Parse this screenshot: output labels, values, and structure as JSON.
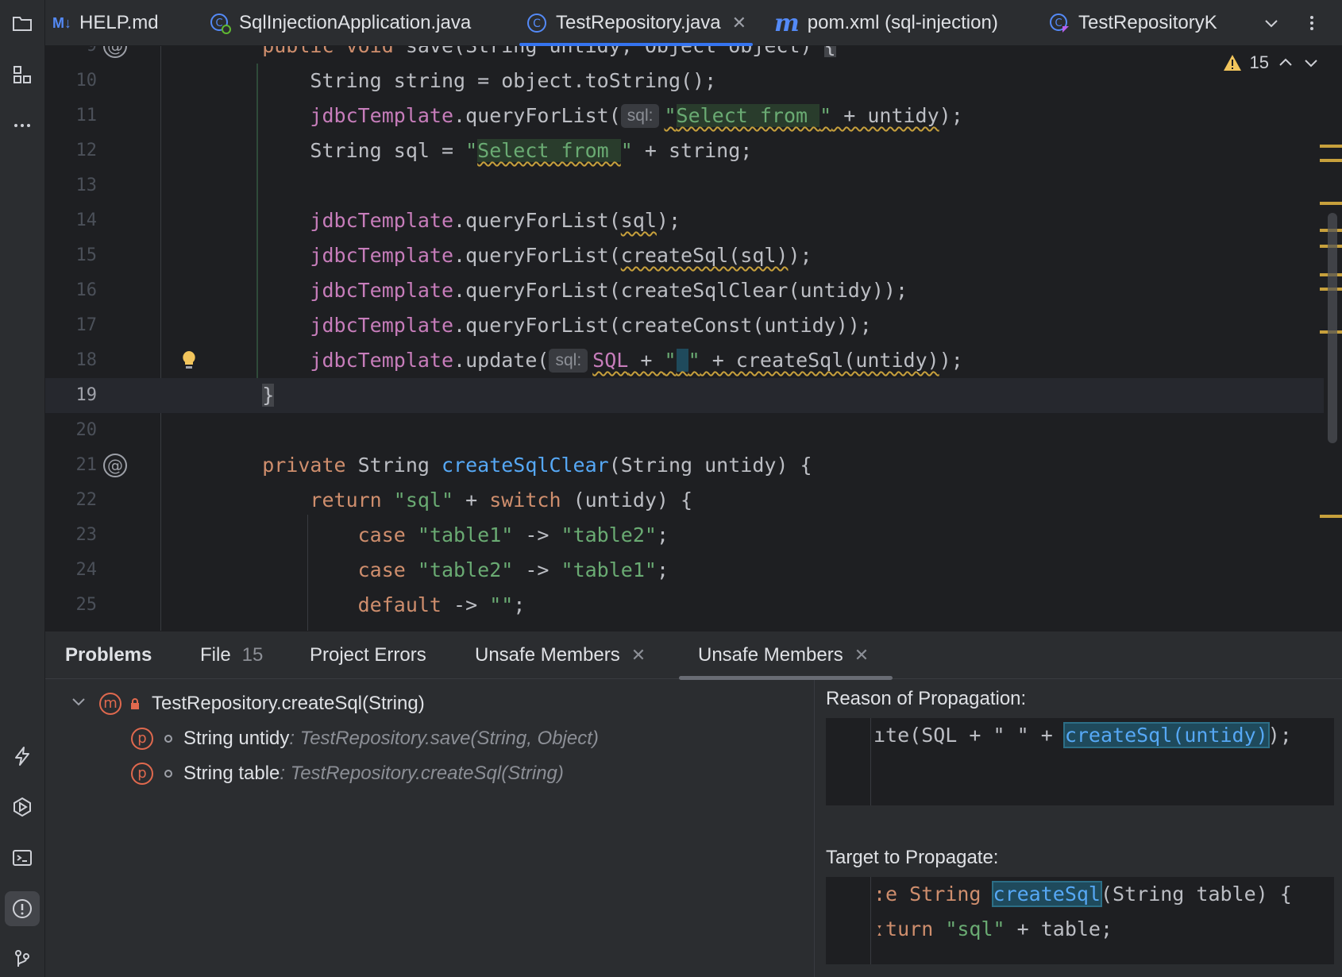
{
  "tabs": [
    {
      "label": "HELP.md",
      "icon": "markdown-icon",
      "active": false
    },
    {
      "label": "SqlInjectionApplication.java",
      "icon": "spring-class-icon",
      "active": false
    },
    {
      "label": "TestRepository.java",
      "icon": "class-icon",
      "active": true,
      "closable": true
    },
    {
      "label": "pom.xml (sql-injection)",
      "icon": "maven-icon",
      "active": false
    },
    {
      "label": "TestRepositoryK",
      "icon": "kotlin-class-icon",
      "active": false
    }
  ],
  "tab_icons": {
    "markdown": "M↓",
    "maven": "m"
  },
  "editor": {
    "warning_count": "15",
    "colors": {
      "keyword": "#cf8e6d",
      "string": "#6aab73",
      "field": "#c77dbb",
      "method": "#56a8f5",
      "warning": "#c7a03c"
    },
    "lines": [
      {
        "n": "9",
        "text": "    public void save(String untidy, Object object) {"
      },
      {
        "n": "10",
        "text": "        String string = object.toString();"
      },
      {
        "n": "11",
        "text": "        jdbcTemplate.queryForList(sql: \"Select from \" + untidy);"
      },
      {
        "n": "12",
        "text": "        String sql = \"Select from \" + string;"
      },
      {
        "n": "13",
        "text": ""
      },
      {
        "n": "14",
        "text": "        jdbcTemplate.queryForList(sql);"
      },
      {
        "n": "15",
        "text": "        jdbcTemplate.queryForList(createSql(sql));"
      },
      {
        "n": "16",
        "text": "        jdbcTemplate.queryForList(createSqlClear(untidy));"
      },
      {
        "n": "17",
        "text": "        jdbcTemplate.queryForList(createConst(untidy));"
      },
      {
        "n": "18",
        "text": "        jdbcTemplate.update(sql: SQL + \" \" + createSql(untidy));"
      },
      {
        "n": "19",
        "text": "    }"
      },
      {
        "n": "20",
        "text": ""
      },
      {
        "n": "21",
        "text": "    private String createSqlClear(String untidy) {"
      },
      {
        "n": "22",
        "text": "        return \"sql\" + switch (untidy) {"
      },
      {
        "n": "23",
        "text": "            case \"table1\" -> \"table2\";"
      },
      {
        "n": "24",
        "text": "            case \"table2\" -> \"table1\";"
      },
      {
        "n": "25",
        "text": "            default -> \"\";"
      }
    ],
    "current_line": "19",
    "inlay_hint": "sql:",
    "gutter_at": "@"
  },
  "bottom": {
    "tabs": [
      {
        "label": "Problems",
        "bold": true
      },
      {
        "label": "File",
        "count": "15"
      },
      {
        "label": "Project Errors"
      },
      {
        "label": "Unsafe Members",
        "closable": true
      },
      {
        "label": "Unsafe Members",
        "closable": true,
        "active": true
      }
    ],
    "tree": {
      "root": "TestRepository.createSql(String)",
      "root_icon_letter": "m",
      "children": [
        {
          "icon_letter": "p",
          "name": "String untidy",
          "location": ": TestRepository.save(String, Object)"
        },
        {
          "icon_letter": "p",
          "name": "String table",
          "location": ": TestRepository.createSql(String)"
        }
      ]
    },
    "reason": {
      "title": "Reason of Propagation:",
      "code_before": "ıte(SQL + \" \" + ",
      "code_selected": "createSql(untidy)",
      "code_after": ");"
    },
    "target": {
      "title": "Target to Propagate:",
      "line1_before": ":e String ",
      "line1_selected": "createSql",
      "line1_after": "(String table) {",
      "line2_before": "ːturn ",
      "line2_string": "\"sql\"",
      "line2_after": " + table;"
    }
  }
}
